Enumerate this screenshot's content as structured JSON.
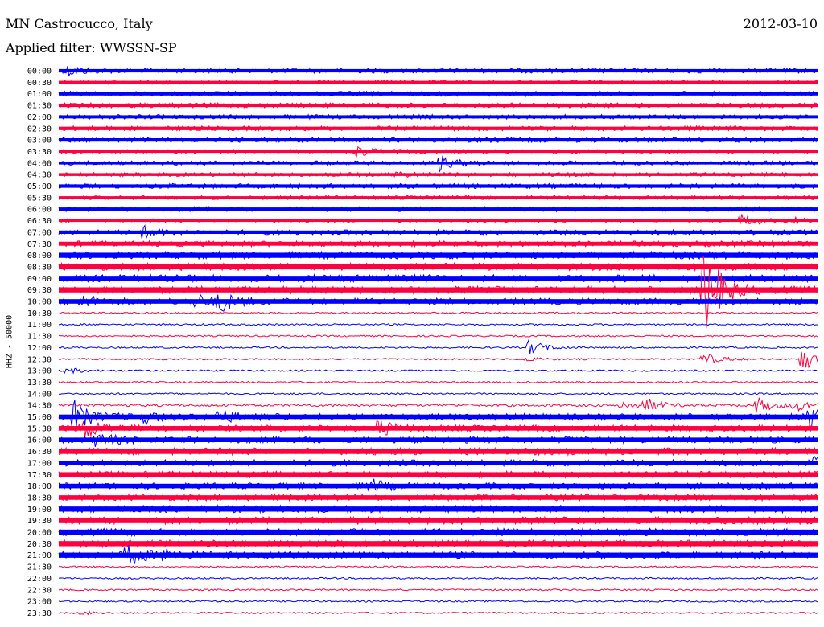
{
  "header": {
    "station": "MN Castrocucco, Italy",
    "date": "2012-03-10",
    "filter": "Applied filter: WWSSN-SP"
  },
  "chart_data": {
    "type": "line",
    "title": "MN Castrocucco, Italy",
    "subtitle": "Applied filter: WWSSN-SP",
    "ylabel": "HHZ - 50000",
    "colors": [
      "#0000ff",
      "#ff0040"
    ],
    "rows": [
      {
        "label": "00:00",
        "noise": 3.0,
        "events": [
          {
            "x": 0.01,
            "amp": 6
          }
        ]
      },
      {
        "label": "00:30",
        "noise": 2.5,
        "events": []
      },
      {
        "label": "01:00",
        "noise": 3.0,
        "events": []
      },
      {
        "label": "01:30",
        "noise": 3.0,
        "events": []
      },
      {
        "label": "02:00",
        "noise": 2.8,
        "events": []
      },
      {
        "label": "02:30",
        "noise": 3.0,
        "events": []
      },
      {
        "label": "03:00",
        "noise": 3.0,
        "events": []
      },
      {
        "label": "03:30",
        "noise": 2.4,
        "events": [
          {
            "x": 0.39,
            "amp": 7
          }
        ]
      },
      {
        "label": "04:00",
        "noise": 2.6,
        "events": [
          {
            "x": 0.5,
            "amp": 9
          }
        ]
      },
      {
        "label": "04:30",
        "noise": 2.5,
        "events": [
          {
            "x": 0.44,
            "amp": 3
          }
        ]
      },
      {
        "label": "05:00",
        "noise": 3.0,
        "events": []
      },
      {
        "label": "05:30",
        "noise": 2.5,
        "events": []
      },
      {
        "label": "06:00",
        "noise": 3.0,
        "events": []
      },
      {
        "label": "06:30",
        "noise": 2.2,
        "events": [
          {
            "x": 0.9,
            "amp": 7
          },
          {
            "x": 0.97,
            "amp": 4
          }
        ]
      },
      {
        "label": "07:00",
        "noise": 3.0,
        "events": [
          {
            "x": 0.11,
            "amp": 7
          }
        ]
      },
      {
        "label": "07:30",
        "noise": 3.5,
        "events": []
      },
      {
        "label": "08:00",
        "noise": 4.5,
        "events": []
      },
      {
        "label": "08:30",
        "noise": 4.5,
        "events": []
      },
      {
        "label": "09:00",
        "noise": 4.5,
        "events": []
      },
      {
        "label": "09:30",
        "noise": 4.5,
        "events": [
          {
            "x": 0.85,
            "amp": 60
          }
        ]
      },
      {
        "label": "10:00",
        "noise": 4.0,
        "events": [
          {
            "x": 0.03,
            "amp": 6
          },
          {
            "x": 0.18,
            "amp": 8
          },
          {
            "x": 0.21,
            "amp": 12
          }
        ]
      },
      {
        "label": "10:30",
        "noise": 1.0,
        "events": []
      },
      {
        "label": "11:00",
        "noise": 1.0,
        "events": []
      },
      {
        "label": "11:30",
        "noise": 1.0,
        "events": []
      },
      {
        "label": "12:00",
        "noise": 1.0,
        "events": [
          {
            "x": 0.62,
            "amp": 10
          }
        ]
      },
      {
        "label": "12:30",
        "noise": 1.0,
        "events": [
          {
            "x": 0.61,
            "amp": 3
          },
          {
            "x": 0.85,
            "amp": 8
          },
          {
            "x": 0.98,
            "amp": 16
          }
        ]
      },
      {
        "label": "13:00",
        "noise": 1.0,
        "events": [
          {
            "x": 0.01,
            "amp": 4
          }
        ]
      },
      {
        "label": "13:30",
        "noise": 1.0,
        "events": []
      },
      {
        "label": "14:00",
        "noise": 1.0,
        "events": []
      },
      {
        "label": "14:30",
        "noise": 1.5,
        "events": [
          {
            "x": 0.74,
            "amp": 5
          },
          {
            "x": 0.77,
            "amp": 10
          },
          {
            "x": 0.92,
            "amp": 10
          },
          {
            "x": 0.97,
            "amp": 8
          }
        ]
      },
      {
        "label": "15:00",
        "noise": 4.0,
        "events": [
          {
            "x": 0.02,
            "amp": 18
          },
          {
            "x": 0.11,
            "amp": 8
          },
          {
            "x": 0.21,
            "amp": 8
          },
          {
            "x": 0.99,
            "amp": 18
          }
        ]
      },
      {
        "label": "15:30",
        "noise": 4.0,
        "events": [
          {
            "x": 0.03,
            "amp": 14
          },
          {
            "x": 0.42,
            "amp": 9
          }
        ]
      },
      {
        "label": "16:00",
        "noise": 4.0,
        "events": [
          {
            "x": 0.05,
            "amp": 8
          }
        ]
      },
      {
        "label": "16:30",
        "noise": 4.5,
        "events": []
      },
      {
        "label": "17:00",
        "noise": 4.0,
        "events": [
          {
            "x": 0.99,
            "amp": 8
          }
        ]
      },
      {
        "label": "17:30",
        "noise": 4.0,
        "events": []
      },
      {
        "label": "18:00",
        "noise": 4.0,
        "events": [
          {
            "x": 0.41,
            "amp": 7
          }
        ]
      },
      {
        "label": "18:30",
        "noise": 4.0,
        "events": []
      },
      {
        "label": "19:00",
        "noise": 4.5,
        "events": []
      },
      {
        "label": "19:30",
        "noise": 4.5,
        "events": []
      },
      {
        "label": "20:00",
        "noise": 4.5,
        "events": []
      },
      {
        "label": "20:30",
        "noise": 4.5,
        "events": []
      },
      {
        "label": "21:00",
        "noise": 4.5,
        "events": [
          {
            "x": 0.09,
            "amp": 12
          },
          {
            "x": 0.14,
            "amp": 6
          }
        ]
      },
      {
        "label": "21:30",
        "noise": 1.0,
        "events": []
      },
      {
        "label": "22:00",
        "noise": 1.0,
        "events": []
      },
      {
        "label": "22:30",
        "noise": 1.0,
        "events": []
      },
      {
        "label": "23:00",
        "noise": 1.0,
        "events": []
      },
      {
        "label": "23:30",
        "noise": 1.0,
        "events": [
          {
            "x": 0.03,
            "amp": 2
          }
        ]
      }
    ]
  }
}
